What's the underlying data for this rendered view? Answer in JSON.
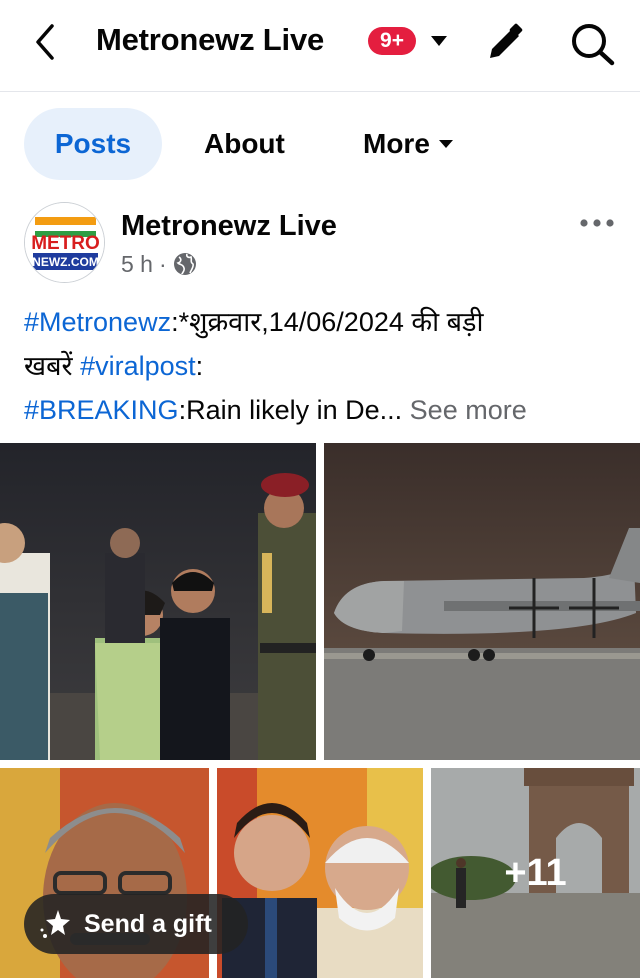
{
  "header": {
    "title": "Metronewz Live",
    "notification_badge": "9+",
    "back_icon": "chevron-left-icon",
    "caret_icon": "caret-down-icon",
    "edit_icon": "pencil-icon",
    "search_icon": "search-icon"
  },
  "tabs": [
    {
      "label": "Posts",
      "active": true
    },
    {
      "label": "About",
      "active": false
    },
    {
      "label": "More",
      "active": false
    }
  ],
  "post": {
    "author": "Metronewz Live",
    "time": "5 h",
    "separator": "·",
    "privacy_icon": "globe-icon",
    "more_icon": "more-horizontal-icon",
    "avatar": {
      "logo_top": "METRO",
      "logo_bottom": "NEWZ.COM"
    },
    "text": {
      "line1_tag": "#Metronewz",
      "line1_rest": ":*शुक्रवार,14/06/2024 की बड़ी",
      "line2_start": "खबरें ",
      "line2_tag": "#viralpost",
      "line2_rest": ":",
      "line3_tag": "#BREAKING",
      "line3_rest": ":Rain likely in De...",
      "see_more": "See more"
    },
    "photos_extra_count": "+11"
  },
  "gift": {
    "label": "Send a gift",
    "icon": "gift-sparkle-icon"
  },
  "colors": {
    "accent_blue": "#0c66d4",
    "active_tab_bg": "#e7f0fb",
    "badge_red": "#e41e3f",
    "muted_text": "#65676b"
  }
}
